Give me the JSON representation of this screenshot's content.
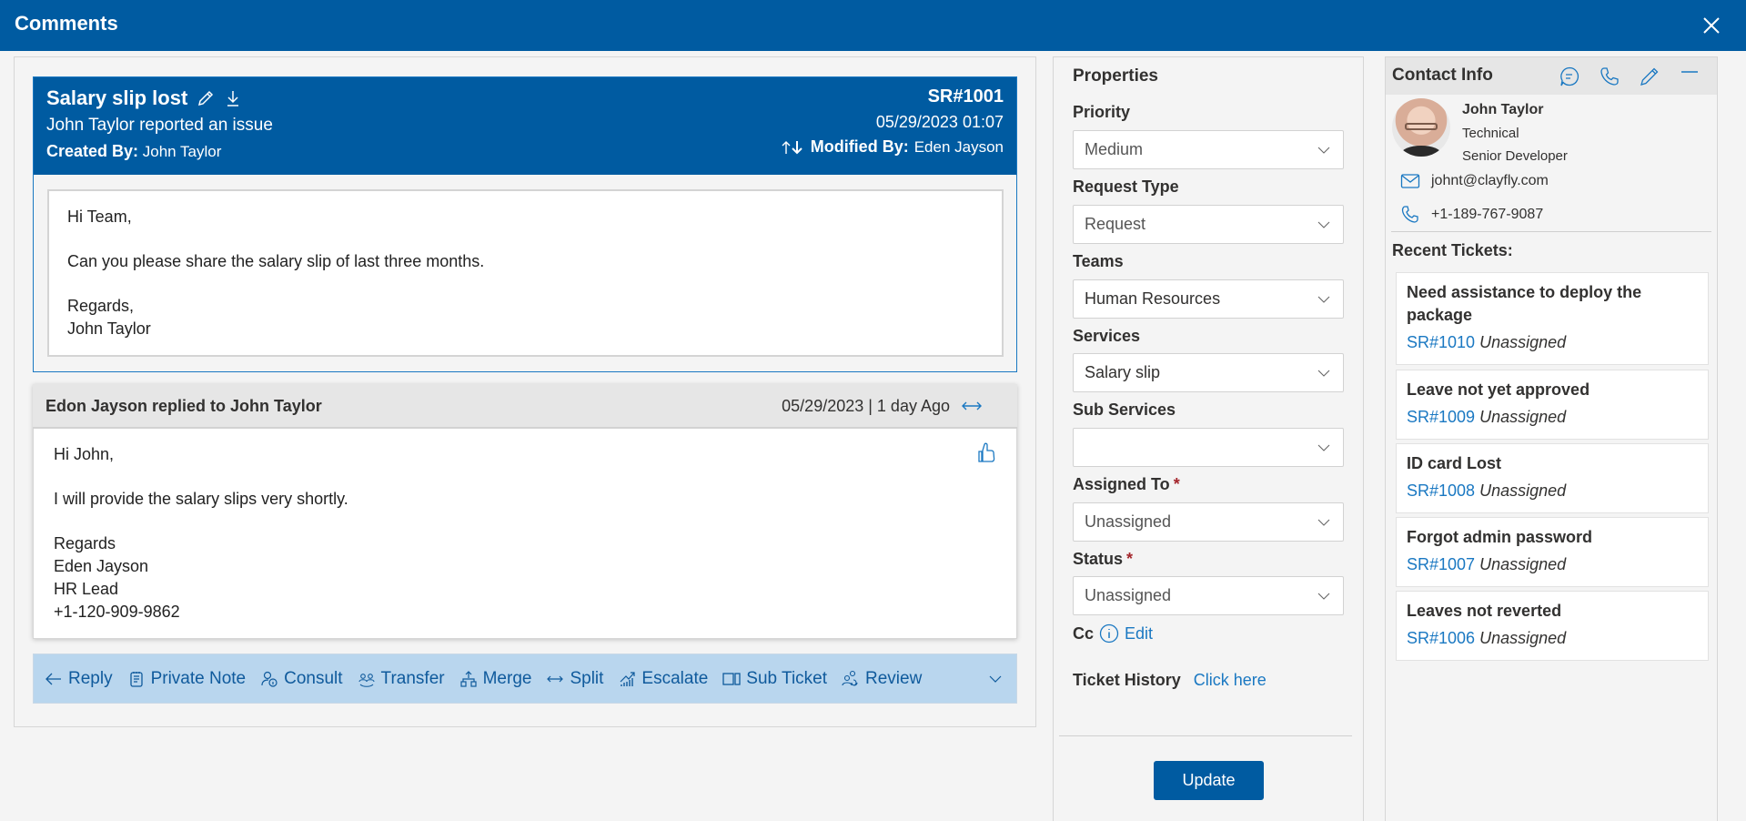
{
  "window": {
    "title": "Comments"
  },
  "ticket": {
    "title": "Salary slip lost",
    "subtitle": "John Taylor reported an issue",
    "created_by_label": "Created By:",
    "created_by": "John Taylor",
    "id": "SR#1001",
    "datetime": "05/29/2023 01:07",
    "modified_by_label": "Modified By:",
    "modified_by": "Eden Jayson",
    "body": {
      "greeting": "Hi Team,",
      "message": "Can you please share the salary slip of last three months.",
      "closing": "Regards,",
      "signature": "John Taylor"
    }
  },
  "reply": {
    "header": "Edon Jayson replied to John Taylor",
    "when": "05/29/2023 | 1 day Ago",
    "body": {
      "greeting": "Hi John,",
      "message": "I will provide the salary slips very shortly.",
      "closing": "Regards",
      "sig_name": "Eden Jayson",
      "sig_title": "HR Lead",
      "sig_phone": "+1-120-909-9862"
    }
  },
  "actions": [
    {
      "label": "Reply",
      "icon": "arrow-left-icon"
    },
    {
      "label": "Private Note",
      "icon": "note-icon"
    },
    {
      "label": "Consult",
      "icon": "consult-icon"
    },
    {
      "label": "Transfer",
      "icon": "transfer-icon"
    },
    {
      "label": "Merge",
      "icon": "merge-icon"
    },
    {
      "label": "Split",
      "icon": "split-icon"
    },
    {
      "label": "Escalate",
      "icon": "escalate-icon"
    },
    {
      "label": "Sub Ticket",
      "icon": "sub-ticket-icon"
    },
    {
      "label": "Review",
      "icon": "review-icon"
    }
  ],
  "properties": {
    "title": "Properties",
    "fields": [
      {
        "label": "Priority",
        "value": "Medium",
        "required": false
      },
      {
        "label": "Request Type",
        "value": "Request",
        "required": false
      },
      {
        "label": "Teams",
        "value": "Human Resources",
        "required": false
      },
      {
        "label": "Services",
        "value": "Salary slip",
        "required": false
      },
      {
        "label": "Sub Services",
        "value": "",
        "required": false
      },
      {
        "label": "Assigned To",
        "value": "Unassigned",
        "required": true
      },
      {
        "label": "Status",
        "value": "Unassigned",
        "required": true
      }
    ],
    "required_mark": "*",
    "cc_label": "Cc",
    "cc_edit": "Edit",
    "history_label": "Ticket History",
    "history_link": "Click here",
    "update_label": "Update"
  },
  "contact": {
    "title": "Contact Info",
    "name": "John Taylor",
    "department": "Technical",
    "role": "Senior Developer",
    "email": "johnt@clayfly.com",
    "phone": "+1-189-767-9087",
    "recent_label": "Recent Tickets:",
    "recent": [
      {
        "title": "Need assistance to deploy the package",
        "id": "SR#1010",
        "status": "Unassigned"
      },
      {
        "title": "Leave not yet approved",
        "id": "SR#1009",
        "status": "Unassigned"
      },
      {
        "title": "ID card Lost",
        "id": "SR#1008",
        "status": "Unassigned"
      },
      {
        "title": "Forgot admin password",
        "id": "SR#1007",
        "status": "Unassigned"
      },
      {
        "title": "Leaves not reverted",
        "id": "SR#1006",
        "status": "Unassigned"
      }
    ]
  },
  "colors": {
    "brand": "#005ba1",
    "link": "#1a78c2",
    "action_bar": "#b9d6ee",
    "required": "#a4262c"
  }
}
